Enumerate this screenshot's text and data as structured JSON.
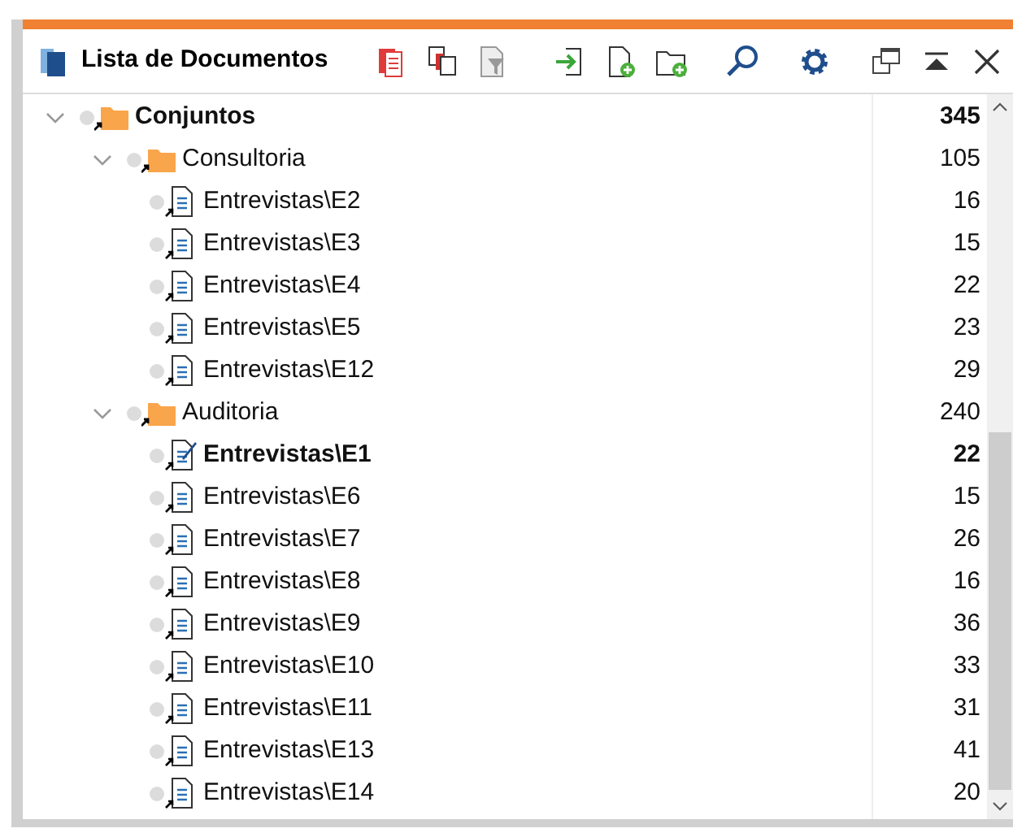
{
  "panel": {
    "title": "Lista de Documentos"
  },
  "tree": [
    {
      "kind": "set",
      "label": "Conjuntos",
      "count": "345",
      "expanded": true,
      "children": [
        {
          "kind": "set",
          "label": "Consultoria",
          "count": "105",
          "expanded": true,
          "children": [
            {
              "kind": "document",
              "label": "Entrevistas\\E2",
              "count": "16",
              "active": false
            },
            {
              "kind": "document",
              "label": "Entrevistas\\E3",
              "count": "15",
              "active": false
            },
            {
              "kind": "document",
              "label": "Entrevistas\\E4",
              "count": "22",
              "active": false
            },
            {
              "kind": "document",
              "label": "Entrevistas\\E5",
              "count": "23",
              "active": false
            },
            {
              "kind": "document",
              "label": "Entrevistas\\E12",
              "count": "29",
              "active": false
            }
          ]
        },
        {
          "kind": "set",
          "label": "Auditoria",
          "count": "240",
          "expanded": true,
          "children": [
            {
              "kind": "document",
              "label": "Entrevistas\\E1",
              "count": "22",
              "active": true
            },
            {
              "kind": "document",
              "label": "Entrevistas\\E6",
              "count": "15",
              "active": false
            },
            {
              "kind": "document",
              "label": "Entrevistas\\E7",
              "count": "26",
              "active": false
            },
            {
              "kind": "document",
              "label": "Entrevistas\\E8",
              "count": "16",
              "active": false
            },
            {
              "kind": "document",
              "label": "Entrevistas\\E9",
              "count": "36",
              "active": false
            },
            {
              "kind": "document",
              "label": "Entrevistas\\E10",
              "count": "33",
              "active": false
            },
            {
              "kind": "document",
              "label": "Entrevistas\\E11",
              "count": "31",
              "active": false
            },
            {
              "kind": "document",
              "label": "Entrevistas\\E13",
              "count": "41",
              "active": false
            },
            {
              "kind": "document",
              "label": "Entrevistas\\E14",
              "count": "20",
              "active": false
            }
          ]
        }
      ]
    }
  ]
}
